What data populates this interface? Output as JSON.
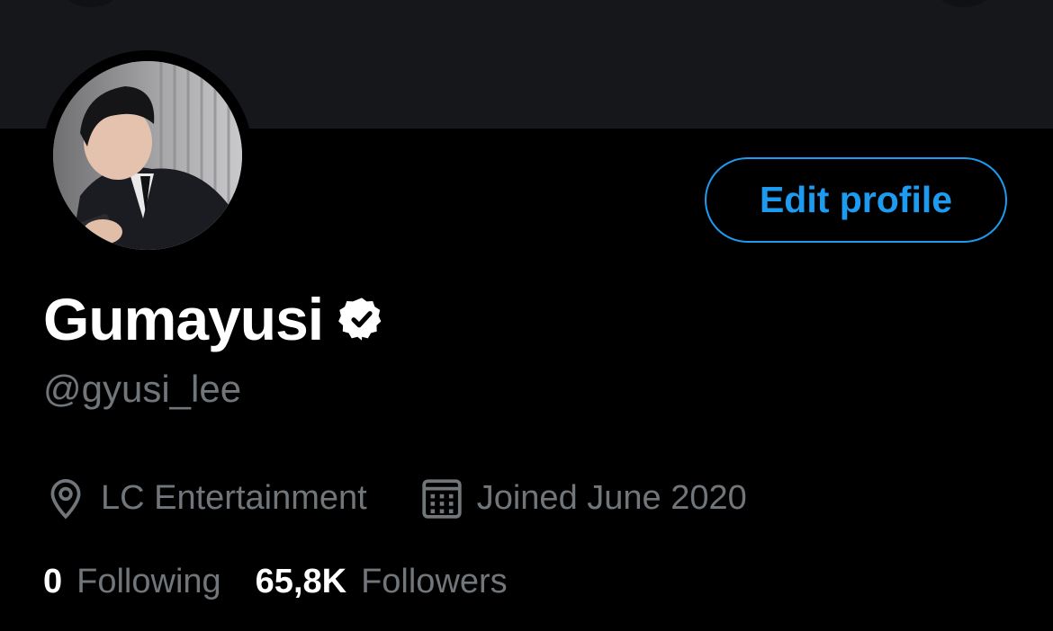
{
  "profile": {
    "display_name": "Gumayusi",
    "handle": "@gyusi_lee",
    "location": "LC Entertainment",
    "joined": "Joined June 2020",
    "verified_icon": "verified-badge-icon",
    "location_icon": "location-pin-icon",
    "calendar_icon": "calendar-icon"
  },
  "actions": {
    "edit_profile_label": "Edit profile"
  },
  "stats": {
    "following_count": "0",
    "following_label": "Following",
    "followers_count": "65,8K",
    "followers_label": "Followers"
  },
  "colors": {
    "background": "#000000",
    "banner": "#16171a",
    "accent": "#1d9bf0",
    "secondary_text": "#71767b",
    "primary_text": "#ffffff"
  }
}
